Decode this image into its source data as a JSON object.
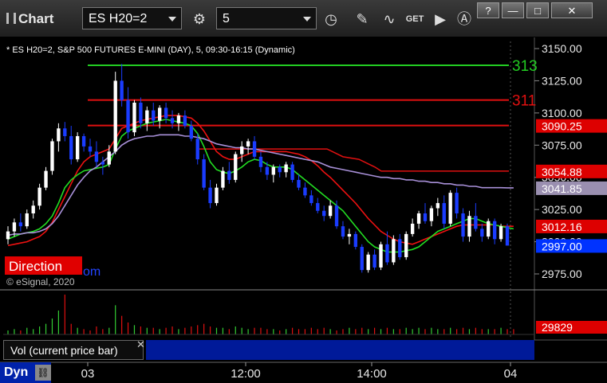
{
  "window": {
    "title": "Chart",
    "symbol": "ES H20=2",
    "interval": "5",
    "help_label": "?",
    "min_label": "—",
    "max_label": "□",
    "close_label": "✕",
    "get_label": "GET"
  },
  "chart_data": {
    "type": "candlestick",
    "header": "* ES H20=2, S&P 500 FUTURES E-MINI (DAY), 5, 09:30-16:15 (Dynamic)",
    "price_ticks": [
      "3150.00",
      "3125.00",
      "3100.00",
      "3075.00",
      "3050.00",
      "3025.00",
      "3000.00",
      "2975.00"
    ],
    "price_tick_values": [
      3150,
      3125,
      3100,
      3075,
      3050,
      3025,
      3000,
      2975
    ],
    "ylim": [
      2966,
      3160
    ],
    "time_ticks": [
      "03",
      "12:00",
      "14:00",
      "04"
    ],
    "horizontal_levels": [
      {
        "value": 3137,
        "color": "#22cc22",
        "label": "313"
      },
      {
        "value": 3110,
        "color": "#e01010",
        "label": "311"
      },
      {
        "value": 3090.25,
        "color": "#e01010",
        "label": ""
      }
    ],
    "price_labels": [
      {
        "text": "3090.25",
        "value": 3090.25,
        "bg": "#dd0000",
        "fg": "#ffffff"
      },
      {
        "text": "3054.88",
        "value": 3054.88,
        "bg": "#dd0000",
        "fg": "#ffffff"
      },
      {
        "text": "3041.85",
        "value": 3041.85,
        "bg": "#9a8fb0",
        "fg": "#ffffff"
      },
      {
        "text": "3012.16",
        "value": 3012.16,
        "bg": "#dd0000",
        "fg": "#ffffff"
      },
      {
        "text": "2997.00",
        "value": 2997.0,
        "bg": "#0033ff",
        "fg": "#ffffff"
      }
    ],
    "candles": [
      {
        "o": 3002,
        "h": 3012,
        "l": 2998,
        "c": 3008
      },
      {
        "o": 3008,
        "h": 3018,
        "l": 3004,
        "c": 3015
      },
      {
        "o": 3015,
        "h": 3022,
        "l": 3008,
        "c": 3012
      },
      {
        "o": 3012,
        "h": 3025,
        "l": 3010,
        "c": 3022
      },
      {
        "o": 3022,
        "h": 3032,
        "l": 3018,
        "c": 3028
      },
      {
        "o": 3028,
        "h": 3045,
        "l": 3025,
        "c": 3042
      },
      {
        "o": 3042,
        "h": 3058,
        "l": 3040,
        "c": 3055
      },
      {
        "o": 3055,
        "h": 3080,
        "l": 3052,
        "c": 3078
      },
      {
        "o": 3078,
        "h": 3092,
        "l": 3070,
        "c": 3088
      },
      {
        "o": 3088,
        "h": 3093,
        "l": 3078,
        "c": 3082
      },
      {
        "o": 3082,
        "h": 3090,
        "l": 3060,
        "c": 3064
      },
      {
        "o": 3064,
        "h": 3085,
        "l": 3062,
        "c": 3082
      },
      {
        "o": 3082,
        "h": 3084,
        "l": 3070,
        "c": 3074
      },
      {
        "o": 3074,
        "h": 3080,
        "l": 3066,
        "c": 3070
      },
      {
        "o": 3070,
        "h": 3078,
        "l": 3058,
        "c": 3062
      },
      {
        "o": 3062,
        "h": 3066,
        "l": 3052,
        "c": 3060
      },
      {
        "o": 3060,
        "h": 3075,
        "l": 3058,
        "c": 3070
      },
      {
        "o": 3070,
        "h": 3132,
        "l": 3068,
        "c": 3125
      },
      {
        "o": 3125,
        "h": 3138,
        "l": 3105,
        "c": 3110
      },
      {
        "o": 3110,
        "h": 3120,
        "l": 3080,
        "c": 3085
      },
      {
        "o": 3085,
        "h": 3110,
        "l": 3082,
        "c": 3108
      },
      {
        "o": 3108,
        "h": 3112,
        "l": 3088,
        "c": 3092
      },
      {
        "o": 3092,
        "h": 3105,
        "l": 3086,
        "c": 3102
      },
      {
        "o": 3102,
        "h": 3108,
        "l": 3090,
        "c": 3094
      },
      {
        "o": 3094,
        "h": 3106,
        "l": 3088,
        "c": 3104
      },
      {
        "o": 3104,
        "h": 3108,
        "l": 3092,
        "c": 3096
      },
      {
        "o": 3096,
        "h": 3102,
        "l": 3088,
        "c": 3092
      },
      {
        "o": 3092,
        "h": 3100,
        "l": 3086,
        "c": 3098
      },
      {
        "o": 3098,
        "h": 3102,
        "l": 3088,
        "c": 3090
      },
      {
        "o": 3090,
        "h": 3094,
        "l": 3078,
        "c": 3080
      },
      {
        "o": 3080,
        "h": 3084,
        "l": 3060,
        "c": 3064
      },
      {
        "o": 3064,
        "h": 3068,
        "l": 3040,
        "c": 3042
      },
      {
        "o": 3042,
        "h": 3048,
        "l": 3026,
        "c": 3030
      },
      {
        "o": 3030,
        "h": 3045,
        "l": 3028,
        "c": 3042
      },
      {
        "o": 3042,
        "h": 3058,
        "l": 3040,
        "c": 3055
      },
      {
        "o": 3055,
        "h": 3062,
        "l": 3045,
        "c": 3048
      },
      {
        "o": 3048,
        "h": 3070,
        "l": 3046,
        "c": 3068
      },
      {
        "o": 3068,
        "h": 3078,
        "l": 3062,
        "c": 3074
      },
      {
        "o": 3074,
        "h": 3080,
        "l": 3068,
        "c": 3078
      },
      {
        "o": 3078,
        "h": 3082,
        "l": 3064,
        "c": 3066
      },
      {
        "o": 3066,
        "h": 3070,
        "l": 3054,
        "c": 3058
      },
      {
        "o": 3058,
        "h": 3062,
        "l": 3048,
        "c": 3052
      },
      {
        "o": 3052,
        "h": 3060,
        "l": 3046,
        "c": 3058
      },
      {
        "o": 3058,
        "h": 3060,
        "l": 3050,
        "c": 3054
      },
      {
        "o": 3054,
        "h": 3062,
        "l": 3050,
        "c": 3060
      },
      {
        "o": 3060,
        "h": 3062,
        "l": 3046,
        "c": 3048
      },
      {
        "o": 3048,
        "h": 3052,
        "l": 3040,
        "c": 3042
      },
      {
        "o": 3042,
        "h": 3046,
        "l": 3034,
        "c": 3036
      },
      {
        "o": 3036,
        "h": 3040,
        "l": 3028,
        "c": 3030
      },
      {
        "o": 3030,
        "h": 3034,
        "l": 3022,
        "c": 3024
      },
      {
        "o": 3024,
        "h": 3028,
        "l": 3016,
        "c": 3020
      },
      {
        "o": 3020,
        "h": 3032,
        "l": 3018,
        "c": 3028
      },
      {
        "o": 3028,
        "h": 3032,
        "l": 3010,
        "c": 3012
      },
      {
        "o": 3012,
        "h": 3016,
        "l": 3002,
        "c": 3004
      },
      {
        "o": 3004,
        "h": 3010,
        "l": 2998,
        "c": 3006
      },
      {
        "o": 3006,
        "h": 3008,
        "l": 2994,
        "c": 2996
      },
      {
        "o": 2996,
        "h": 2998,
        "l": 2976,
        "c": 2978
      },
      {
        "o": 2978,
        "h": 2992,
        "l": 2976,
        "c": 2990
      },
      {
        "o": 2990,
        "h": 2994,
        "l": 2978,
        "c": 2980
      },
      {
        "o": 2980,
        "h": 3000,
        "l": 2978,
        "c": 2998
      },
      {
        "o": 2998,
        "h": 3008,
        "l": 2982,
        "c": 2984
      },
      {
        "o": 2984,
        "h": 3005,
        "l": 2982,
        "c": 3002
      },
      {
        "o": 3002,
        "h": 3006,
        "l": 2986,
        "c": 2988
      },
      {
        "o": 2988,
        "h": 3008,
        "l": 2986,
        "c": 3006
      },
      {
        "o": 3006,
        "h": 3018,
        "l": 3004,
        "c": 3014
      },
      {
        "o": 3014,
        "h": 3024,
        "l": 3010,
        "c": 3022
      },
      {
        "o": 3022,
        "h": 3030,
        "l": 3014,
        "c": 3016
      },
      {
        "o": 3016,
        "h": 3028,
        "l": 3012,
        "c": 3026
      },
      {
        "o": 3026,
        "h": 3034,
        "l": 3020,
        "c": 3030
      },
      {
        "o": 3030,
        "h": 3036,
        "l": 3010,
        "c": 3014
      },
      {
        "o": 3014,
        "h": 3040,
        "l": 3012,
        "c": 3038
      },
      {
        "o": 3038,
        "h": 3042,
        "l": 3018,
        "c": 3022
      },
      {
        "o": 3022,
        "h": 3026,
        "l": 3000,
        "c": 3004
      },
      {
        "o": 3004,
        "h": 3024,
        "l": 3000,
        "c": 3020
      },
      {
        "o": 3020,
        "h": 3030,
        "l": 3008,
        "c": 3010
      },
      {
        "o": 3010,
        "h": 3014,
        "l": 3000,
        "c": 3004
      },
      {
        "o": 3004,
        "h": 3018,
        "l": 3002,
        "c": 3016
      },
      {
        "o": 3016,
        "h": 3018,
        "l": 2998,
        "c": 3002
      },
      {
        "o": 3002,
        "h": 3014,
        "l": 3000,
        "c": 3012
      },
      {
        "o": 3012,
        "h": 3014,
        "l": 2997,
        "c": 2997
      }
    ],
    "overlays": [
      {
        "name": "red-ma",
        "color": "#ee1111",
        "values": [
          2997,
          2998,
          2999,
          3000,
          3002,
          3004,
          3008,
          3015,
          3025,
          3035,
          3045,
          3055,
          3062,
          3066,
          3068,
          3070,
          3072,
          3080,
          3088,
          3090,
          3092,
          3094,
          3095,
          3096,
          3097,
          3098,
          3098,
          3098,
          3097,
          3096,
          3092,
          3086,
          3078,
          3070,
          3066,
          3064,
          3064,
          3066,
          3068,
          3070,
          3070,
          3070,
          3070,
          3070,
          3070,
          3069,
          3068,
          3066,
          3063,
          3059,
          3054,
          3050,
          3045,
          3040,
          3035,
          3030,
          3024,
          3018,
          3013,
          3008,
          3005,
          3002,
          3000,
          2999,
          2998,
          3000,
          3002,
          3004,
          3006,
          3008,
          3010,
          3012,
          3013,
          3013,
          3013,
          3013,
          3013,
          3013,
          3012,
          3012,
          3012
        ]
      },
      {
        "name": "green-ma",
        "color": "#22dd22",
        "values": [
          3002,
          3004,
          3006,
          3007,
          3008,
          3010,
          3014,
          3020,
          3030,
          3042,
          3048,
          3052,
          3055,
          3056,
          3057,
          3058,
          3060,
          3072,
          3082,
          3086,
          3088,
          3090,
          3092,
          3093,
          3094,
          3095,
          3094,
          3093,
          3092,
          3090,
          3084,
          3074,
          3062,
          3056,
          3054,
          3053,
          3055,
          3058,
          3062,
          3064,
          3063,
          3060,
          3058,
          3058,
          3058,
          3056,
          3052,
          3048,
          3044,
          3040,
          3036,
          3032,
          3028,
          3024,
          3018,
          3012,
          3006,
          3000,
          2996,
          2994,
          2992,
          2992,
          2992,
          2993,
          2994,
          2996,
          3000,
          3004,
          3008,
          3010,
          3012,
          3014,
          3016,
          3018,
          3018,
          3016,
          3014,
          3013,
          3012,
          3011,
          3010
        ]
      },
      {
        "name": "purple-ma",
        "color": "#a890d8",
        "values": [
          3005,
          3006,
          3006,
          3007,
          3007,
          3008,
          3010,
          3014,
          3020,
          3028,
          3036,
          3044,
          3050,
          3055,
          3058,
          3062,
          3066,
          3070,
          3075,
          3078,
          3080,
          3081,
          3082,
          3082,
          3083,
          3083,
          3083,
          3083,
          3082,
          3082,
          3081,
          3080,
          3078,
          3076,
          3075,
          3074,
          3073,
          3073,
          3072,
          3072,
          3071,
          3070,
          3069,
          3068,
          3067,
          3066,
          3065,
          3064,
          3063,
          3062,
          3060,
          3058,
          3057,
          3056,
          3055,
          3054,
          3053,
          3052,
          3051,
          3050,
          3050,
          3049,
          3049,
          3048,
          3048,
          3047,
          3047,
          3046,
          3046,
          3045,
          3045,
          3044,
          3044,
          3043,
          3043,
          3042,
          3042,
          3042,
          3042,
          3041.85,
          3041.85
        ]
      }
    ],
    "volume": {
      "label": "Vol (current price bar)",
      "last_value": "29829",
      "values": [
        3,
        4,
        3,
        5,
        4,
        6,
        8,
        12,
        18,
        30,
        8,
        5,
        4,
        3,
        6,
        4,
        5,
        22,
        14,
        9,
        7,
        6,
        5,
        5,
        4,
        5,
        6,
        4,
        5,
        6,
        7,
        8,
        6,
        5,
        5,
        4,
        6,
        5,
        4,
        5,
        5,
        4,
        4,
        3,
        4,
        5,
        4,
        4,
        5,
        4,
        5,
        4,
        3,
        4,
        5,
        4,
        5,
        4,
        5,
        4,
        5,
        4,
        4,
        5,
        4,
        5,
        4,
        5,
        4,
        4,
        5,
        4,
        5,
        4,
        5,
        4,
        4,
        4,
        5,
        4,
        4
      ]
    },
    "watermarks": {
      "direction": "Direction",
      "com": "om",
      "copyright": "© eSignal, 2020"
    },
    "cursor_label": "Dyn"
  }
}
